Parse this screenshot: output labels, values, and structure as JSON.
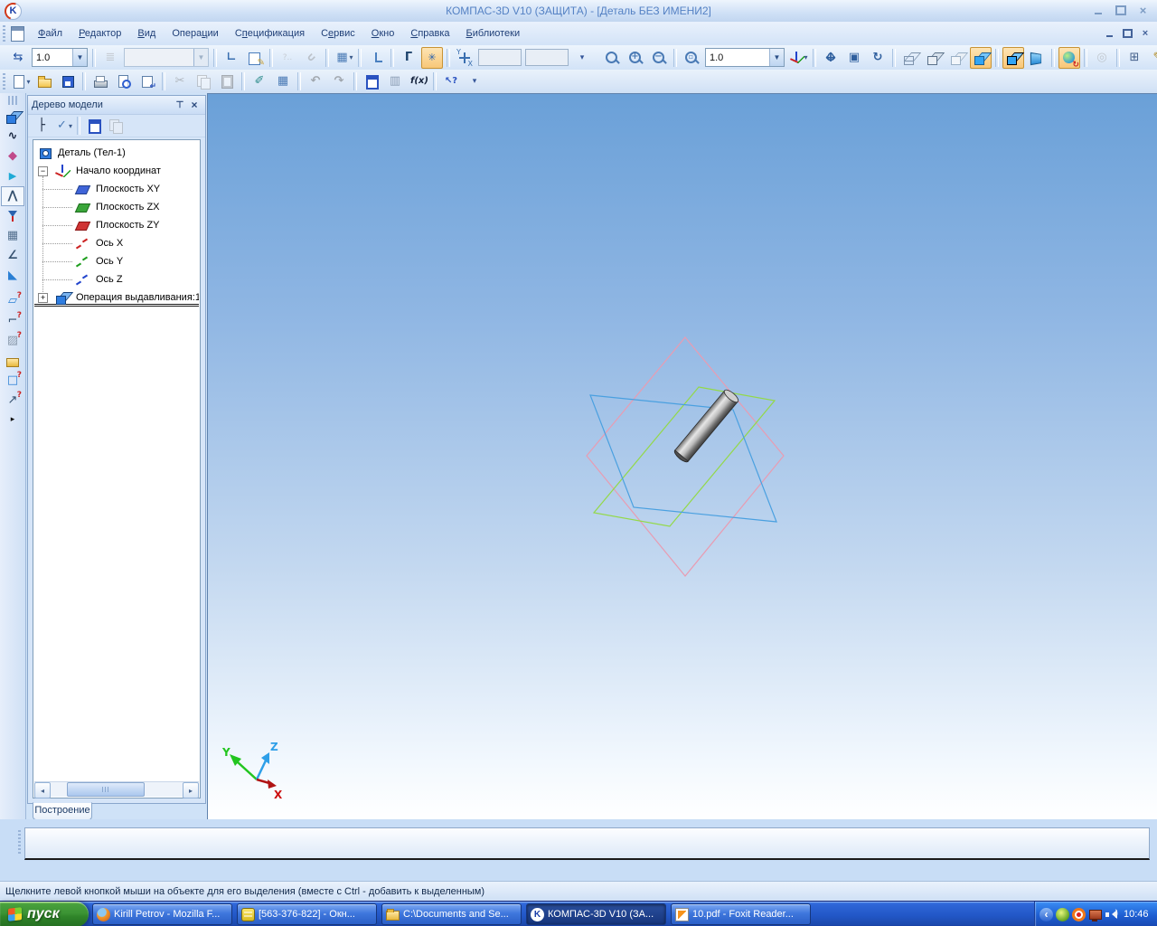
{
  "window": {
    "title": "КОМПАС-3D V10 (ЗАЩИТА) - [Деталь БЕЗ ИМЕНИ2]"
  },
  "menu": [
    {
      "label": "Файл",
      "u": 0
    },
    {
      "label": "Редактор",
      "u": 0
    },
    {
      "label": "Вид",
      "u": 0
    },
    {
      "label": "Операции",
      "u": 5
    },
    {
      "label": "Спецификация",
      "u": 1
    },
    {
      "label": "Сервис",
      "u": 1
    },
    {
      "label": "Окно",
      "u": 0
    },
    {
      "label": "Справка",
      "u": 0
    },
    {
      "label": "Библиотеки",
      "u": 0
    }
  ],
  "toolbars": {
    "current_state": [
      {
        "name": "current-step",
        "icon": "step",
        "glyph": "⇆"
      },
      {
        "combo": true,
        "name": "step-combo",
        "value": "1.0"
      },
      {
        "sep": true
      },
      {
        "name": "layers",
        "icon": "layers",
        "glyph": "≣",
        "disabled": true
      },
      {
        "combo": true,
        "name": "layers-combo",
        "value": "",
        "disabled": true
      },
      {
        "sep": true
      },
      {
        "name": "edit-vertices",
        "icon": "vertex",
        "glyph": "∟"
      },
      {
        "name": "sketch-table",
        "icon": "notebook"
      },
      {
        "sep": true
      },
      {
        "name": "erase-auxiliary",
        "icon": "eraser",
        "glyph": "?..",
        "disabled": true
      },
      {
        "name": "snap-magnet",
        "icon": "magnet",
        "disabled": true
      },
      {
        "sep": true
      },
      {
        "name": "grid",
        "icon": "grid",
        "glyph": "▦",
        "dd": true
      },
      {
        "sep": true
      },
      {
        "name": "local-csys",
        "icon": "laxes"
      },
      {
        "sep": true
      },
      {
        "name": "orthogonal-drawing",
        "icon": "ortho",
        "glyph": "Г"
      },
      {
        "name": "snaps",
        "icon": "snap",
        "glyph": "✳",
        "active": true
      },
      {
        "sep": true
      },
      {
        "name": "coords-display",
        "icon": "coords"
      },
      {
        "field": true,
        "name": "y-coordinate-field"
      },
      {
        "field": true,
        "name": "x-coordinate-field"
      },
      {
        "name": "toolbar-options-state",
        "icon": "more",
        "glyph": "▾"
      }
    ],
    "view": [
      {
        "name": "zoom-area",
        "icon": "mag"
      },
      {
        "name": "zoom-in",
        "icon": "mag-plus"
      },
      {
        "name": "zoom-out",
        "icon": "mag-minus"
      },
      {
        "sep": true
      },
      {
        "name": "zoom-by-scale",
        "icon": "mag-rect"
      },
      {
        "combo": true,
        "name": "zoom-combo",
        "value": "1.0"
      },
      {
        "name": "orientation",
        "icon": "axes3",
        "dd": true
      },
      {
        "sep": true
      },
      {
        "name": "pan",
        "icon": "pan"
      },
      {
        "name": "zoom-window",
        "icon": "frame",
        "glyph": "▣"
      },
      {
        "name": "rotate-view",
        "icon": "rotate",
        "glyph": "↻"
      },
      {
        "sep": true
      },
      {
        "name": "wireframe-display",
        "icon": "cube-wire",
        "cube": true
      },
      {
        "name": "hidden-lines-display",
        "icon": "cube-hidden",
        "cube": true
      },
      {
        "name": "hidden-lines-thin-display",
        "icon": "cube-thin",
        "cube": true
      },
      {
        "name": "shaded-display",
        "icon": "cube-shaded",
        "cube": true,
        "active": true
      },
      {
        "sep": true
      },
      {
        "name": "shaded-wireframe-display",
        "icon": "cube-edges",
        "cube": true,
        "active": true
      },
      {
        "name": "perspective-display",
        "icon": "persp"
      },
      {
        "sep": true
      },
      {
        "name": "simplified-display",
        "icon": "sphere",
        "active": true
      },
      {
        "sep": true
      },
      {
        "name": "hide-scroll",
        "icon": "scroll",
        "glyph": "◎",
        "disabled": true
      },
      {
        "sep": true
      },
      {
        "name": "rebuild-model",
        "icon": "rebuild",
        "glyph": "⊞"
      },
      {
        "name": "sketch-mode",
        "icon": "pencil",
        "glyph": "✎"
      },
      {
        "name": "properties-window",
        "icon": "panel",
        "glyph": "⊟"
      },
      {
        "name": "toolbar-options-view",
        "icon": "more",
        "glyph": "▾"
      }
    ],
    "standard": [
      {
        "name": "new-document",
        "icon": "page",
        "dd": true
      },
      {
        "name": "open-document",
        "icon": "folder-open"
      },
      {
        "name": "save-document",
        "icon": "floppy"
      },
      {
        "sep": true
      },
      {
        "name": "print",
        "icon": "printer"
      },
      {
        "name": "print-preview",
        "icon": "preview"
      },
      {
        "name": "insert-fragment",
        "icon": "insert"
      },
      {
        "sep": true
      },
      {
        "name": "cut",
        "icon": "cut",
        "glyph": "✂",
        "disabled": true
      },
      {
        "name": "copy",
        "icon": "copy",
        "disabled": true
      },
      {
        "name": "paste",
        "icon": "paste",
        "disabled": true
      },
      {
        "sep": true
      },
      {
        "name": "copy-properties",
        "icon": "brush",
        "glyph": "✐"
      },
      {
        "name": "spreadsheet",
        "icon": "table",
        "glyph": "▦"
      },
      {
        "sep": true
      },
      {
        "name": "undo",
        "icon": "undo",
        "glyph": "↶",
        "disabled": true
      },
      {
        "name": "redo",
        "icon": "redo",
        "glyph": "↷",
        "disabled": true
      },
      {
        "sep": true
      },
      {
        "name": "variables-window",
        "icon": "variables"
      },
      {
        "name": "macros",
        "icon": "macro",
        "glyph": "▥"
      },
      {
        "name": "function-fx",
        "icon": "fx",
        "glyph": "f(x)"
      },
      {
        "sep": true
      },
      {
        "name": "context-help",
        "icon": "help",
        "glyph": "↖?"
      },
      {
        "name": "toolbar-options-standard",
        "icon": "more",
        "glyph": "▾"
      }
    ]
  },
  "compact_panel": [
    {
      "name": "edit-part",
      "icon": "cp-part"
    },
    {
      "name": "space-curves",
      "icon": "cp-curve",
      "glyph": "∿"
    },
    {
      "name": "surfaces",
      "icon": "cp-surface",
      "glyph": "◆"
    },
    {
      "name": "auxiliary-geometry",
      "icon": "cp-aux",
      "glyph": "▶"
    },
    {
      "name": "measurements-3d",
      "icon": "cp-measure",
      "glyph": "⋀",
      "pressed": true
    },
    {
      "name": "filters",
      "icon": "cp-filter"
    },
    {
      "name": "specification",
      "icon": "cp-spec",
      "glyph": "▦"
    },
    {
      "name": "conditional-marks",
      "icon": "cp-dim",
      "glyph": "∠"
    },
    {
      "name": "sheet-metal-body",
      "icon": "cp-sheet",
      "glyph": "◣"
    },
    {
      "sep": true
    },
    {
      "name": "check-plane",
      "icon": "cp-q1",
      "glyph": "▱",
      "q": true
    },
    {
      "name": "check-contour",
      "icon": "cp-q2",
      "glyph": "⌐",
      "q": true
    },
    {
      "name": "check-hatch",
      "icon": "cp-q3",
      "glyph": "▨",
      "q": true
    },
    {
      "name": "library-folder",
      "icon": "cp-folder"
    },
    {
      "name": "check-body",
      "icon": "cp-box",
      "glyph": "□",
      "q": true
    },
    {
      "name": "check-direction",
      "icon": "cp-q4",
      "glyph": "↗",
      "q": true
    }
  ],
  "panel": {
    "title": "Дерево модели",
    "tab": "Построение",
    "tools": [
      {
        "name": "tree-structure",
        "icon": "treestruct",
        "glyph": "├"
      },
      {
        "name": "tree-display-filter",
        "icon": "checklist",
        "glyph": "✓",
        "dd": true
      },
      {
        "sep": true
      },
      {
        "name": "report",
        "icon": "doc"
      },
      {
        "name": "copy-tree",
        "icon": "doc2",
        "disabled": true
      }
    ]
  },
  "tree": [
    {
      "label": "Деталь (Тел-1)",
      "icon": "t-part",
      "lvl": 0
    },
    {
      "label": "Начало координат",
      "icon": "t-origin",
      "lvl": 1,
      "expander": "−"
    },
    {
      "label": "Плоскость XY",
      "icon": "t-plane-xy",
      "lvl": 2
    },
    {
      "label": "Плоскость ZX",
      "icon": "t-plane-zx",
      "lvl": 2
    },
    {
      "label": "Плоскость ZY",
      "icon": "t-plane-zy",
      "lvl": 2
    },
    {
      "label": "Ось X",
      "icon": "t-axis-x",
      "lvl": 2
    },
    {
      "label": "Ось Y",
      "icon": "t-axis-y",
      "lvl": 2
    },
    {
      "label": "Ось Z",
      "icon": "t-axis-z",
      "lvl": 2
    },
    {
      "label": "Операция выдавливания:1",
      "icon": "t-extrude",
      "lvl": 1,
      "expander": "+",
      "current": true
    }
  ],
  "viewport": {
    "triad_labels": {
      "x": "X",
      "y": "Y",
      "z": "Z"
    },
    "plane_colors": {
      "zy_front": "#e89cb2",
      "zx": "#93d948",
      "xy": "#4aa0e0"
    },
    "triad_colors": {
      "x": "#b01414",
      "y": "#22c51f",
      "z": "#2e9fe8"
    }
  },
  "status": {
    "message": "Щелкните левой кнопкой мыши на объекте для его выделения (вместе с Ctrl - добавить к выделенным)"
  },
  "taskbar": {
    "start_label": "пуск",
    "clock": "10:46",
    "tasks": [
      {
        "label": "Kirill Petrov - Mozilla F...",
        "icon": "tb-firefox",
        "active": false
      },
      {
        "label": "[563-376-822] - Окн...",
        "icon": "tb-icq",
        "active": false
      },
      {
        "label": "C:\\Documents and Se...",
        "icon": "tb-folder",
        "active": false
      },
      {
        "label": "КОМПАС-3D V10 (ЗА...",
        "icon": "tb-kompas",
        "active": true
      },
      {
        "label": "10.pdf - Foxit Reader...",
        "icon": "tb-foxit",
        "active": false
      }
    ],
    "tray": [
      {
        "name": "tray-collapse",
        "cls": "tr-collapse"
      },
      {
        "name": "tray-messenger",
        "cls": "tr-flower"
      },
      {
        "name": "tray-agent",
        "cls": "tr-agent"
      },
      {
        "name": "tray-display",
        "cls": "tr-display"
      },
      {
        "name": "tray-volume",
        "cls": "tr-volume"
      }
    ]
  }
}
